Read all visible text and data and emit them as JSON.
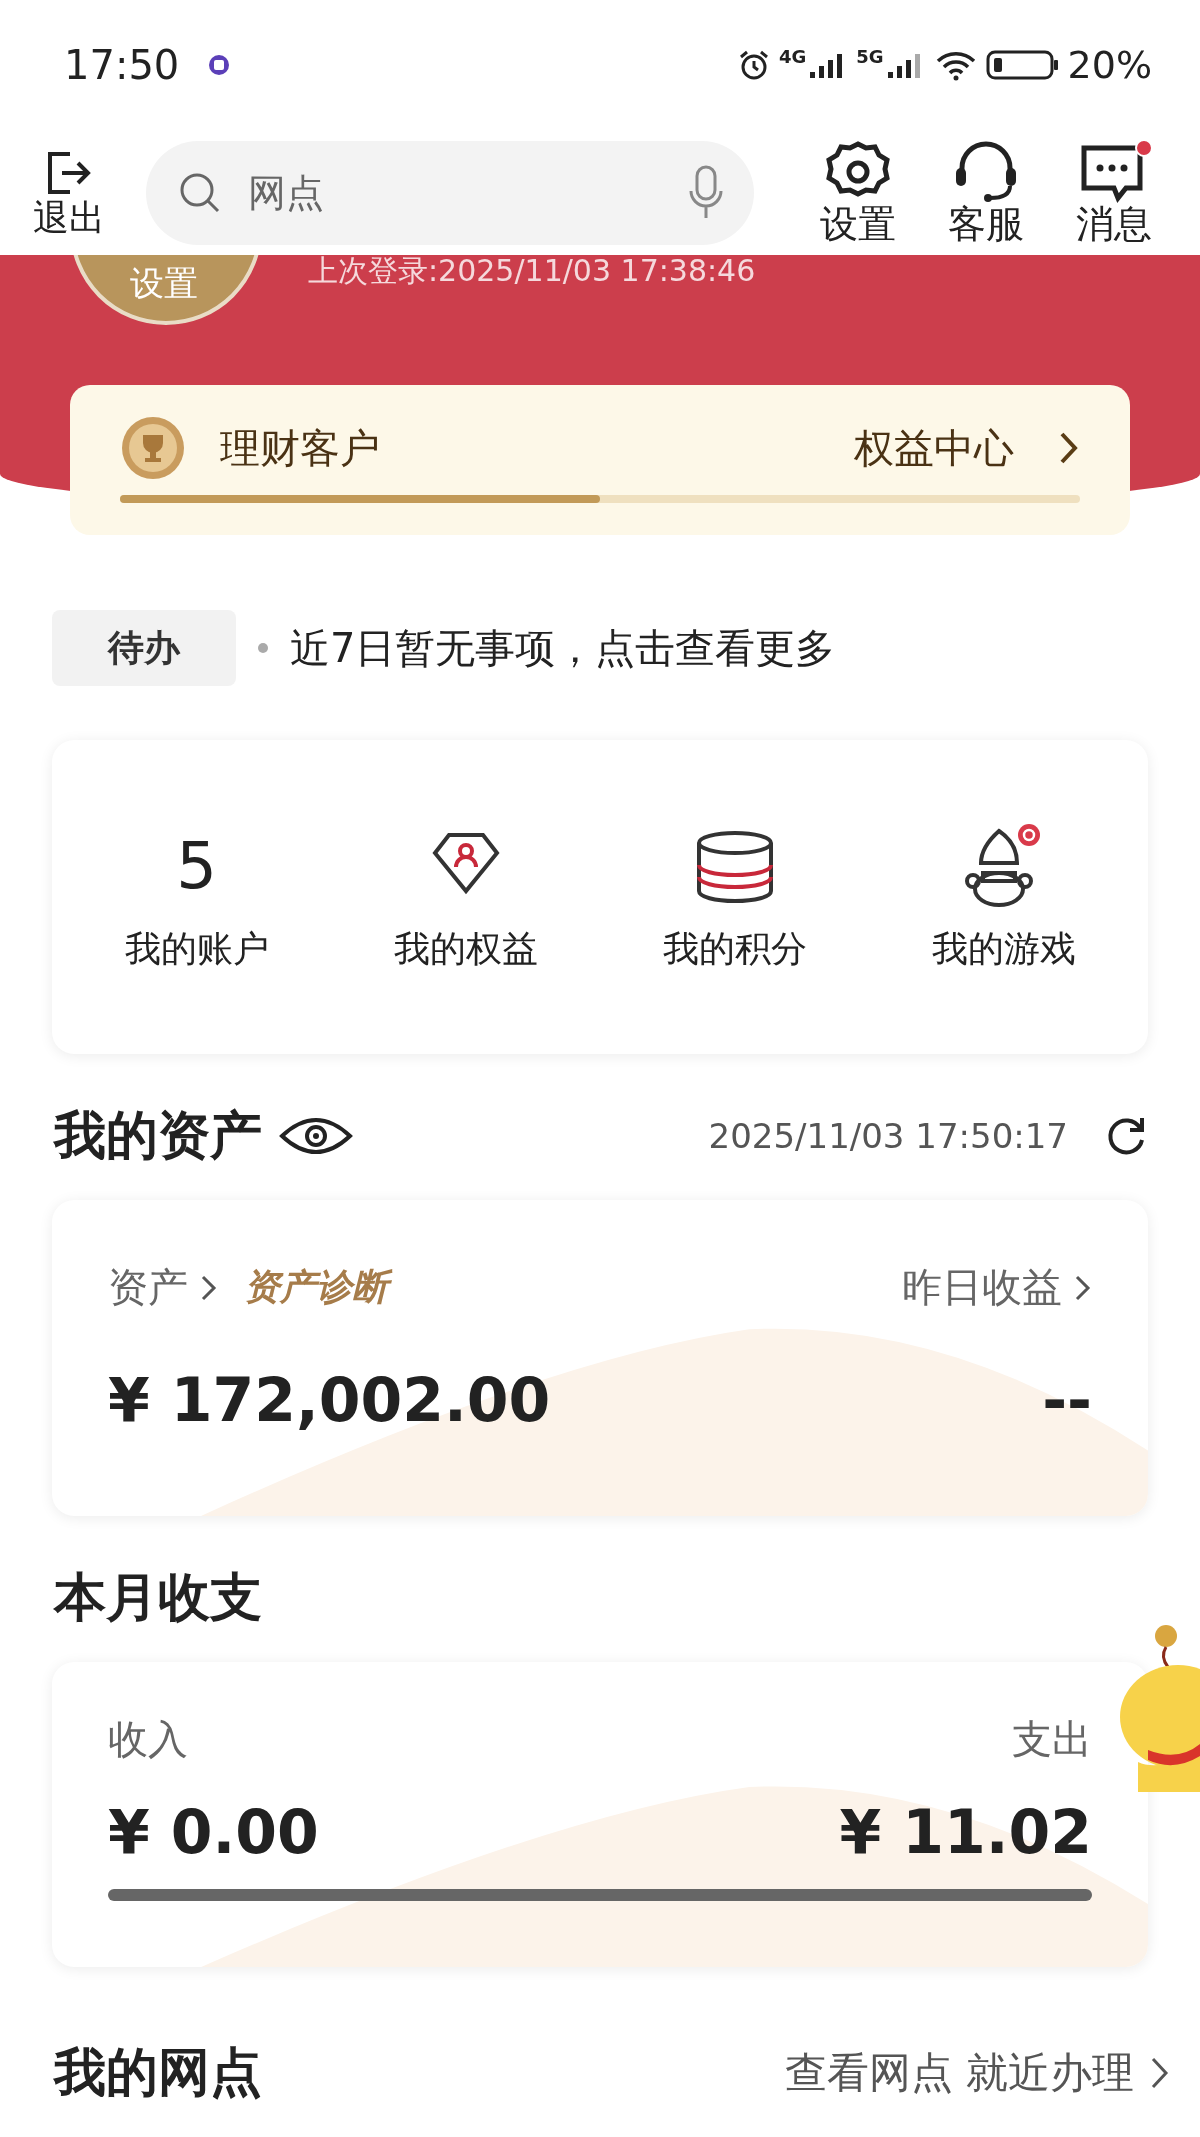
{
  "status_bar": {
    "time": "17:50",
    "network_1": "4G",
    "network_2": "5G",
    "battery": "20%"
  },
  "header": {
    "logout_label": "退出",
    "search": {
      "placeholder": "网点"
    },
    "actions": [
      {
        "kind": "settings",
        "label": "设置"
      },
      {
        "kind": "service",
        "label": "客服"
      },
      {
        "kind": "message",
        "label": "消息",
        "badge": true
      }
    ]
  },
  "profile": {
    "avatar_label": "设置",
    "last_login": "上次登录:2025/11/03 17:38:46"
  },
  "tier": {
    "name": "理财客户",
    "link": "权益中心",
    "level": 0.5
  },
  "todo": {
    "tag": "待办",
    "text": "近7日暂无事项，点击查看更多"
  },
  "shortcuts": [
    {
      "kind": "count",
      "value": "5",
      "label": "我的账户"
    },
    {
      "kind": "rights",
      "label": "我的权益"
    },
    {
      "kind": "points",
      "label": "我的积分"
    },
    {
      "kind": "game",
      "label": "我的游戏",
      "badge": true
    }
  ],
  "assets": {
    "title": "我的资产",
    "updated": "2025/11/03 17:50:17",
    "left_label": "资产",
    "diagnosis": "资产诊断",
    "right_label": "昨日收益",
    "amount": "¥ 172,002.00",
    "yesterday": "--"
  },
  "monthly": {
    "title": "本月收支",
    "income_label": "收入",
    "expense_label": "支出",
    "income": "¥ 0.00",
    "expense": "¥ 11.02"
  },
  "branch": {
    "title": "我的网点",
    "link": "查看网点 就近办理"
  }
}
